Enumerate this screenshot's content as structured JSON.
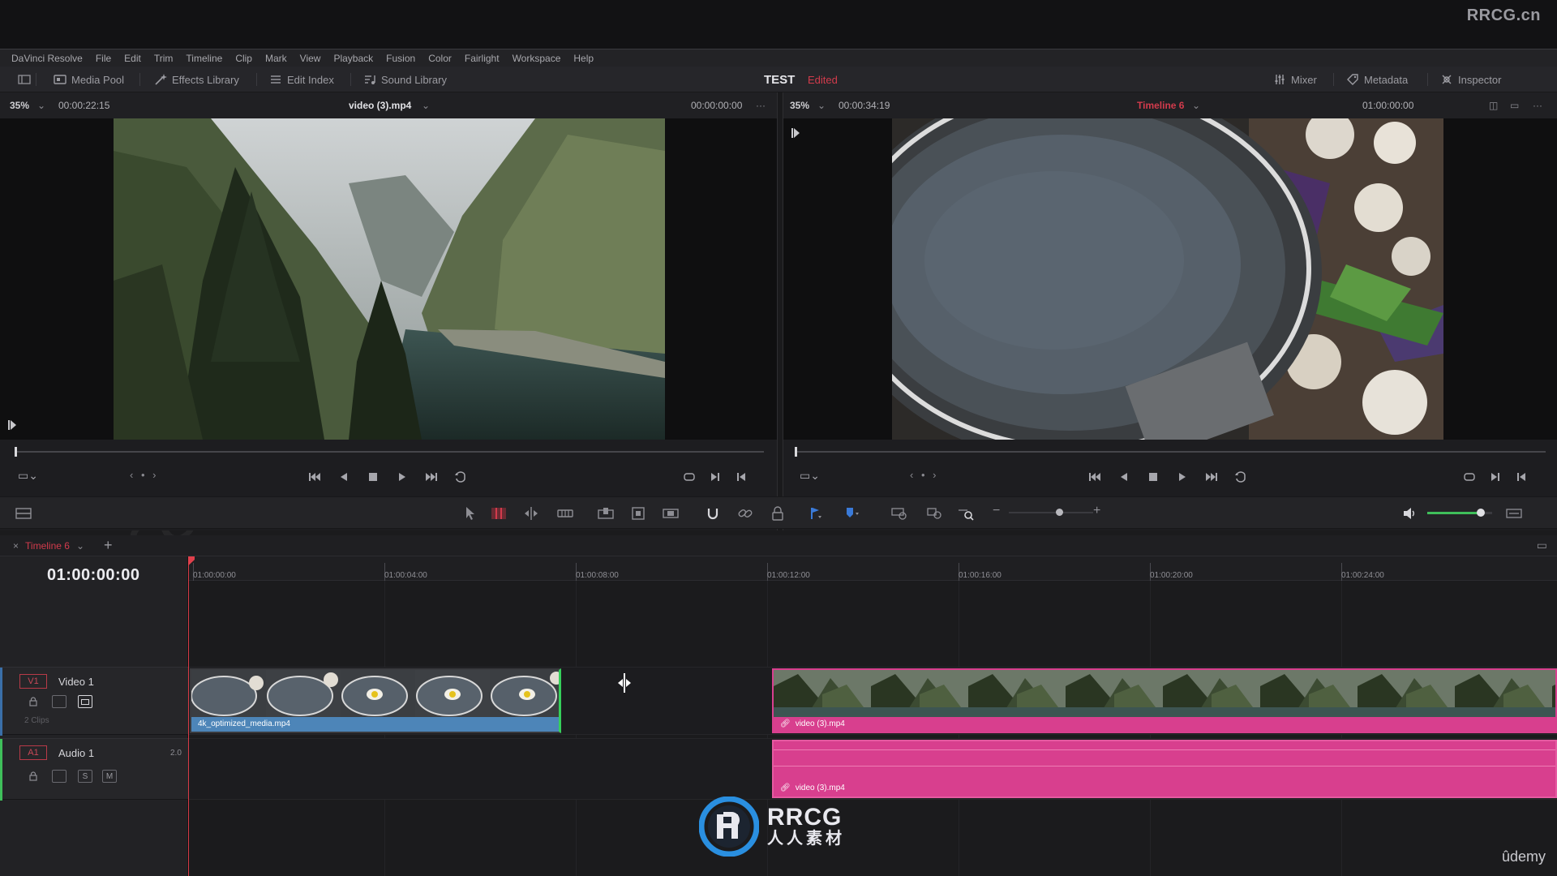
{
  "watermark": {
    "site": "RRCG.cn",
    "brand": "RRCG",
    "brand_cn": "人人素材",
    "udemy": "ûdemy"
  },
  "menu": [
    "DaVinci Resolve",
    "File",
    "Edit",
    "Trim",
    "Timeline",
    "Clip",
    "Mark",
    "View",
    "Playback",
    "Fusion",
    "Color",
    "Fairlight",
    "Workspace",
    "Help"
  ],
  "toolbar": {
    "media_pool": "Media Pool",
    "effects_library": "Effects Library",
    "edit_index": "Edit Index",
    "sound_library": "Sound Library",
    "project_name": "TEST",
    "project_status": "Edited",
    "mixer": "Mixer",
    "metadata": "Metadata",
    "inspector": "Inspector"
  },
  "source_viewer": {
    "zoom": "35%",
    "duration": "00:00:22:15",
    "clip_name": "video (3).mp4",
    "timecode": "00:00:00:00"
  },
  "timeline_viewer": {
    "zoom": "35%",
    "duration": "00:00:34:19",
    "timeline_name": "Timeline 6",
    "timecode": "01:00:00:00"
  },
  "timeline": {
    "tab_name": "Timeline 6",
    "timecode": "01:00:00:00",
    "ruler": [
      "01:00:00:00",
      "01:00:04:00",
      "01:00:08:00",
      "01:00:12:00",
      "01:00:16:00",
      "01:00:20:00",
      "01:00:24:00"
    ],
    "tracks": {
      "video": {
        "id": "V1",
        "name": "Video 1",
        "clip_count": "2 Clips"
      },
      "audio": {
        "id": "A1",
        "name": "Audio 1",
        "channels": "2.0",
        "solo": "S",
        "mute": "M"
      }
    },
    "clips": {
      "v1_a": "4k_optimized_media.mp4",
      "v1_b": "video (3).mp4",
      "a1_b": "video (3).mp4"
    }
  },
  "colors": {
    "accent_red": "#d23b4c",
    "clip_blue": "#4d85b8",
    "clip_pink": "#d83f8e",
    "volume_green": "#3fbf5a"
  }
}
